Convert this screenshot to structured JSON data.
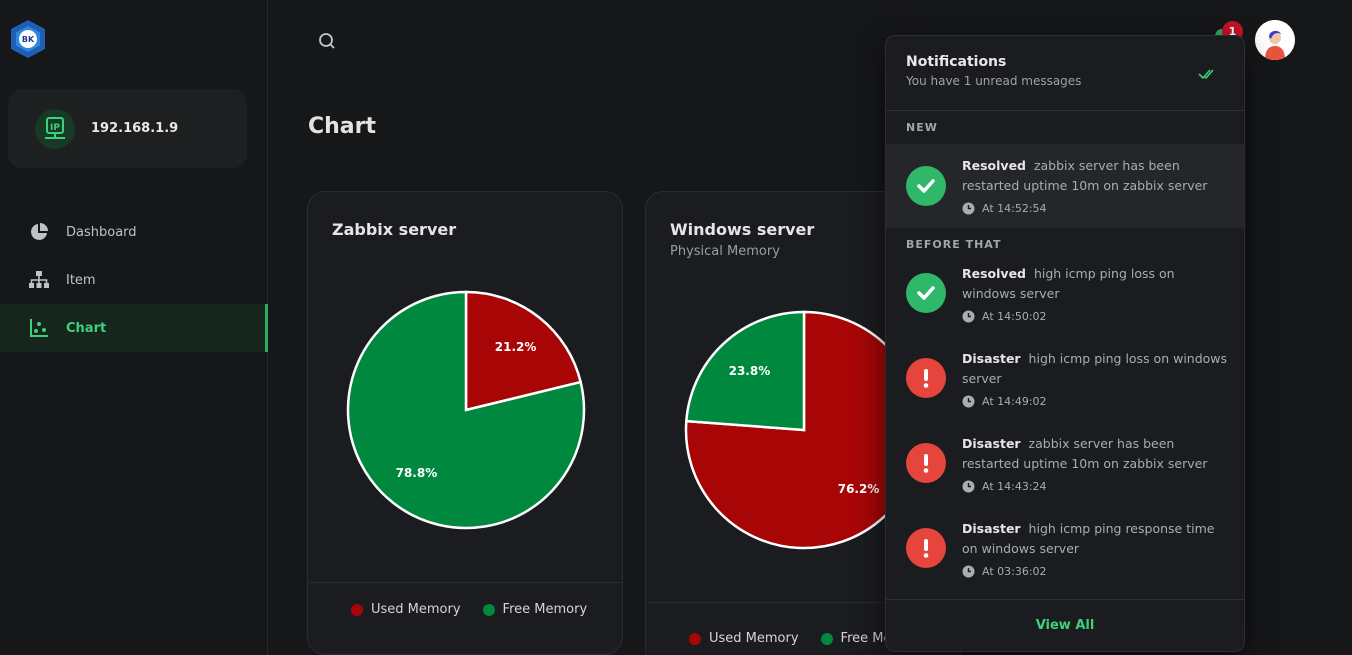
{
  "sidebar": {
    "host_ip": "192.168.1.9",
    "items": [
      {
        "label": "Dashboard",
        "icon": "pie-chart-icon"
      },
      {
        "label": "Item",
        "icon": "sitemap-icon"
      },
      {
        "label": "Chart",
        "icon": "scatter-chart-icon"
      }
    ],
    "active_item": "Chart",
    "logo_text": "BK"
  },
  "header": {
    "notification_count": "1"
  },
  "page": {
    "title": "Chart"
  },
  "cards": [
    {
      "title": "Zabbix server",
      "subtitle": "",
      "legend": [
        "Used Memory",
        "Free Memory"
      ]
    },
    {
      "title": "Windows server",
      "subtitle": "Physical Memory",
      "legend": [
        "Used Memory",
        "Free Memory"
      ]
    }
  ],
  "chart_data": [
    {
      "type": "pie",
      "title": "Zabbix server",
      "categories": [
        "Used Memory",
        "Free Memory"
      ],
      "values": [
        21.2,
        78.8
      ],
      "labels": [
        "21.2%",
        "78.8%"
      ],
      "colors": [
        "#a80606",
        "#00893e"
      ]
    },
    {
      "type": "pie",
      "title": "Windows server",
      "subtitle": "Physical Memory",
      "categories": [
        "Used Memory",
        "Free Memory"
      ],
      "values": [
        76.2,
        23.8
      ],
      "labels": [
        "76.2%",
        "23.8%"
      ],
      "colors": [
        "#a80606",
        "#00893e"
      ]
    }
  ],
  "notifications": {
    "title": "Notifications",
    "subtitle": "You have 1 unread messages",
    "new_label": "NEW",
    "before_label": "BEFORE THAT",
    "view_all": "View All",
    "new_items": [
      {
        "status": "Resolved",
        "message": "zabbix server has been restarted uptime 10m on zabbix server",
        "time": "At 14:52:54",
        "kind": "resolved"
      }
    ],
    "items": [
      {
        "status": "Resolved",
        "message": "high icmp ping loss on windows server",
        "time": "At 14:50:02",
        "kind": "resolved"
      },
      {
        "status": "Disaster",
        "message": "high icmp ping loss on windows server",
        "time": "At 14:49:02",
        "kind": "disaster"
      },
      {
        "status": "Disaster",
        "message": "zabbix server has been restarted uptime 10m on zabbix server",
        "time": "At 14:43:24",
        "kind": "disaster"
      },
      {
        "status": "Disaster",
        "message": "high icmp ping response time on windows server",
        "time": "At 03:36:02",
        "kind": "disaster"
      }
    ]
  },
  "colors": {
    "accent": "#3cd17c",
    "used": "#a80606",
    "free": "#00893e",
    "resolved": "#2fb86a",
    "disaster": "#e5453d",
    "badge": "#c8112b"
  }
}
